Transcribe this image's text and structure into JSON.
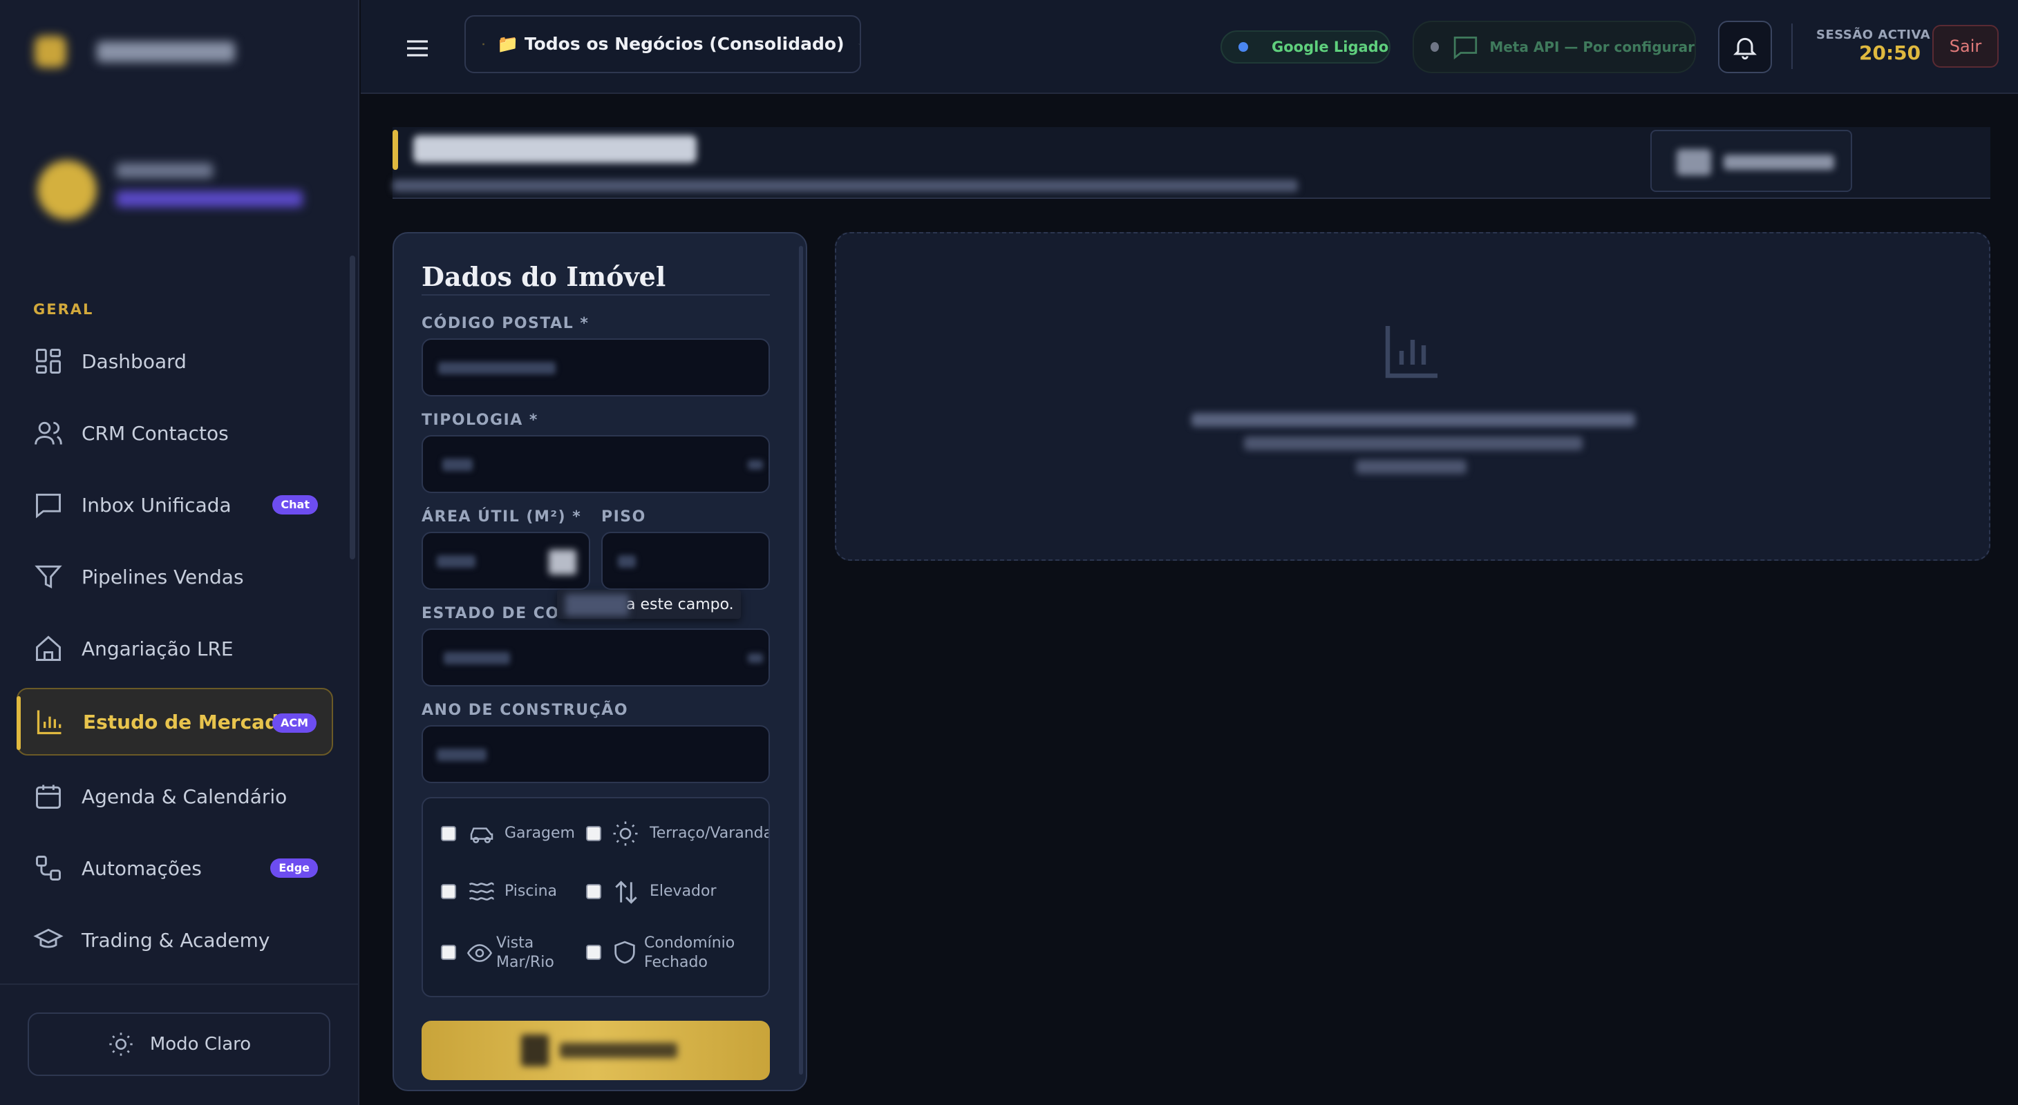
{
  "sidebar": {
    "section_label": "GERAL",
    "items": [
      {
        "label": "Dashboard",
        "icon": "dashboard-icon"
      },
      {
        "label": "CRM Contactos",
        "icon": "users-icon"
      },
      {
        "label": "Inbox Unificada",
        "icon": "chat-bubble-icon",
        "badge": "Chat"
      },
      {
        "label": "Pipelines Vendas",
        "icon": "funnel-icon"
      },
      {
        "label": "Angariação LRE",
        "icon": "home-icon"
      },
      {
        "label": "Estudo de Mercado",
        "icon": "bar-chart-icon",
        "badge": "ACM",
        "active": true
      },
      {
        "label": "Agenda & Calendário",
        "icon": "calendar-icon"
      },
      {
        "label": "Automações",
        "icon": "workflow-icon",
        "badge": "Edge"
      },
      {
        "label": "Trading & Academy",
        "icon": "graduation-cap-icon"
      }
    ],
    "theme_toggle": "Modo Claro"
  },
  "header": {
    "business_selector": "📁 Todos os Negócios (Consolidado)",
    "google_status": "Google Ligado",
    "meta_status": "Meta API — Por configurar",
    "session_label": "SESSÃO ACTIVA",
    "session_time": "20:50",
    "logout": "Sair"
  },
  "form": {
    "title": "Dados do Imóvel",
    "postal_code_label": "CÓDIGO POSTAL *",
    "typology_label": "TIPOLOGIA *",
    "area_label": "ÁREA ÚTIL (M²) *",
    "floor_label": "PISO",
    "state_label": "ESTADO DE CONS",
    "tooltip": "a este campo.",
    "year_label": "ANO DE CONSTRUÇÃO",
    "amenities": [
      "Garagem",
      "Terraço/Varanda",
      "Piscina",
      "Elevador",
      "Vista Mar/Rio",
      "Condomínio Fechado"
    ]
  },
  "colors": {
    "accent_gold": "#e0b93f",
    "badge_purple": "#6d4df0",
    "google_green": "#5fd07d",
    "logout_red": "#e07a7a"
  }
}
